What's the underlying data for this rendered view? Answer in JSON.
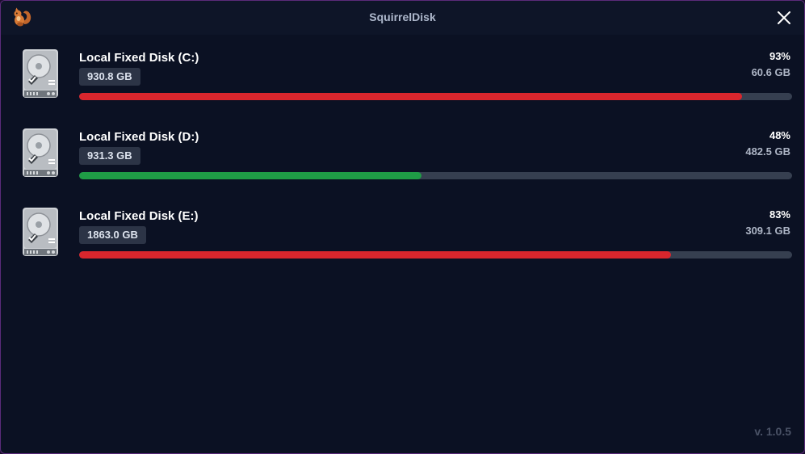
{
  "window": {
    "title": "SquirrelDisk",
    "app_icon": "squirrel-icon",
    "close_icon": "close-icon"
  },
  "disks": [
    {
      "name": "Local Fixed Disk (C:)",
      "total": "930.8 GB",
      "percent": "93%",
      "used_fraction": 0.93,
      "free": "60.6 GB",
      "bar_color": "#d9262d",
      "icon": "hard-drive-icon"
    },
    {
      "name": "Local Fixed Disk (D:)",
      "total": "931.3 GB",
      "percent": "48%",
      "used_fraction": 0.48,
      "free": "482.5 GB",
      "bar_color": "#1f9d46",
      "icon": "hard-drive-icon"
    },
    {
      "name": "Local Fixed Disk (E:)",
      "total": "1863.0 GB",
      "percent": "83%",
      "used_fraction": 0.83,
      "free": "309.1 GB",
      "bar_color": "#d9262d",
      "icon": "hard-drive-icon"
    }
  ],
  "footer": {
    "version": "v. 1.0.5"
  }
}
